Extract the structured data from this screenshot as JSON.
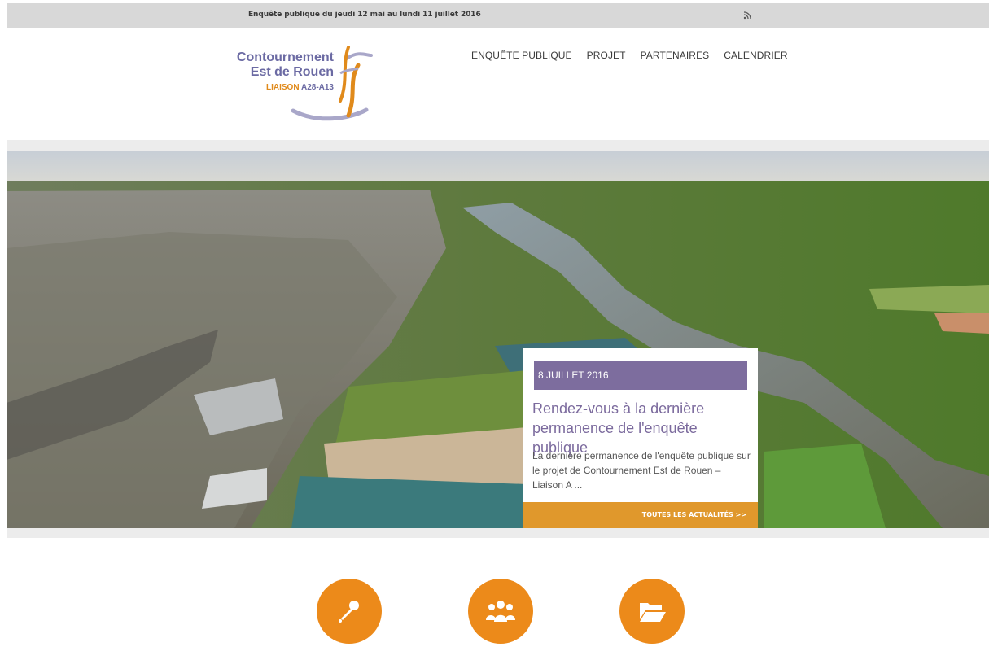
{
  "topbar": {
    "text": "Enquête publique du jeudi 12 mai au lundi 11 juillet 2016"
  },
  "icons": {
    "rss": "rss-icon",
    "mic": "microphone-icon",
    "people": "people-icon",
    "folder": "folder-open-icon"
  },
  "logo": {
    "line1": "Contournement",
    "line2": "Est de Rouen",
    "line3a": "LIAISON",
    "line3b": "A28-A13"
  },
  "nav": {
    "items": [
      "ENQUÊTE PUBLIQUE",
      "PROJET",
      "PARTENAIRES",
      "CALENDRIER"
    ]
  },
  "news": {
    "date": "8 JUILLET 2016",
    "title": "Rendez-vous à la dernière permanence de l'enquête publique",
    "excerpt": "La dernière permanence de l'enquête publique sur le projet de Contournement Est de Rouen – Liaison A ...",
    "all_link": "TOUTES LES ACTUALITÉS >>"
  },
  "colors": {
    "orange": "#ec8a1a",
    "purple": "#7d6d9e",
    "news_bar": "#e0982c",
    "topbar": "#d8d8d8"
  }
}
